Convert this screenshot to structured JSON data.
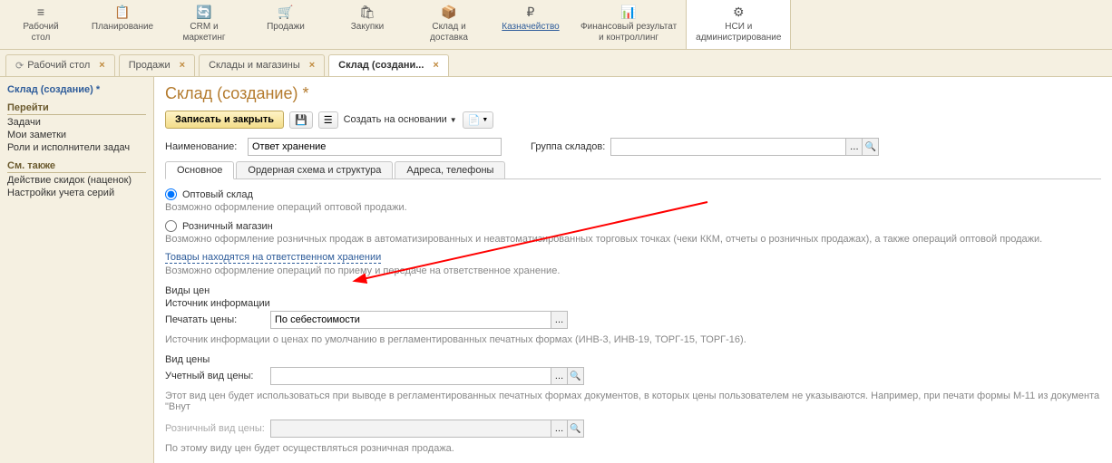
{
  "toolbar": {
    "items": [
      {
        "icon": "≡",
        "label": "Рабочий\nстол"
      },
      {
        "icon": "📋",
        "label": "Планирование"
      },
      {
        "icon": "🔄",
        "label": "CRM и\nмаркетинг"
      },
      {
        "icon": "🛒",
        "label": "Продажи"
      },
      {
        "icon": "🛍",
        "label": "Закупки"
      },
      {
        "icon": "📦",
        "label": "Склад и\nдоставка"
      },
      {
        "icon": "₽",
        "label": "Казначейство",
        "link": true
      },
      {
        "icon": "📊",
        "label": "Финансовый результат\nи контроллинг"
      },
      {
        "icon": "⚙",
        "label": "НСИ и\nадминистрирование",
        "active": true
      }
    ]
  },
  "tabs": {
    "items": [
      {
        "icon": "⟳",
        "label": "Рабочий стол"
      },
      {
        "label": "Продажи"
      },
      {
        "label": "Склады и магазины"
      },
      {
        "label": "Склад (создани...",
        "active": true
      }
    ]
  },
  "sidebar": {
    "title": "Склад (создание) *",
    "section1_heading": "Перейти",
    "links1": [
      "Задачи",
      "Мои заметки",
      "Роли и исполнители задач"
    ],
    "section2_heading": "См. также",
    "links2": [
      "Действие скидок (наценок)",
      "Настройки учета серий"
    ]
  },
  "page": {
    "title": "Склад (создание) *",
    "cmd": {
      "save_close": "Записать и закрыть",
      "create_based": "Создать на основании"
    },
    "name_label": "Наименование:",
    "name_value": "Ответ хранение",
    "group_label": "Группа складов:",
    "inner_tabs": [
      "Основное",
      "Ордерная схема и структура",
      "Адреса, телефоны"
    ],
    "opt_wholesale": "Оптовый склад",
    "hint_wholesale": "Возможно оформление операций оптовой продажи.",
    "opt_retail": "Розничный магазин",
    "hint_retail": "Возможно оформление розничных продаж в автоматизированных и неавтоматизированных торговых точках (чеки ККМ, отчеты о розничных продажах), а также операций оптовой продажи.",
    "link_custody": "Товары находятся на ответственном хранении",
    "hint_custody": "Возможно оформление операций по приему и передаче на ответственное хранение.",
    "prices_heading": "Виды цен",
    "info_source": "Источник информации",
    "print_prices_label": "Печатать цены:",
    "print_prices_value": "По себестоимости",
    "hint_print": "Источник информации о ценах по умолчанию в регламентированных печатных формах (ИНВ-3, ИНВ-19, ТОРГ-15, ТОРГ-16).",
    "price_type_heading": "Вид цены",
    "acct_price_label": "Учетный вид цены:",
    "hint_acct": "Этот вид цен будет использоваться при выводе в регламентированных печатных формах документов, в которых цены пользователем не указываются. Например, при печати формы М-11 из документа \"Внут",
    "retail_price_label": "Розничный вид цены:",
    "hint_retail_price": "По этому виду цен будет осуществляться розничная продажа."
  }
}
